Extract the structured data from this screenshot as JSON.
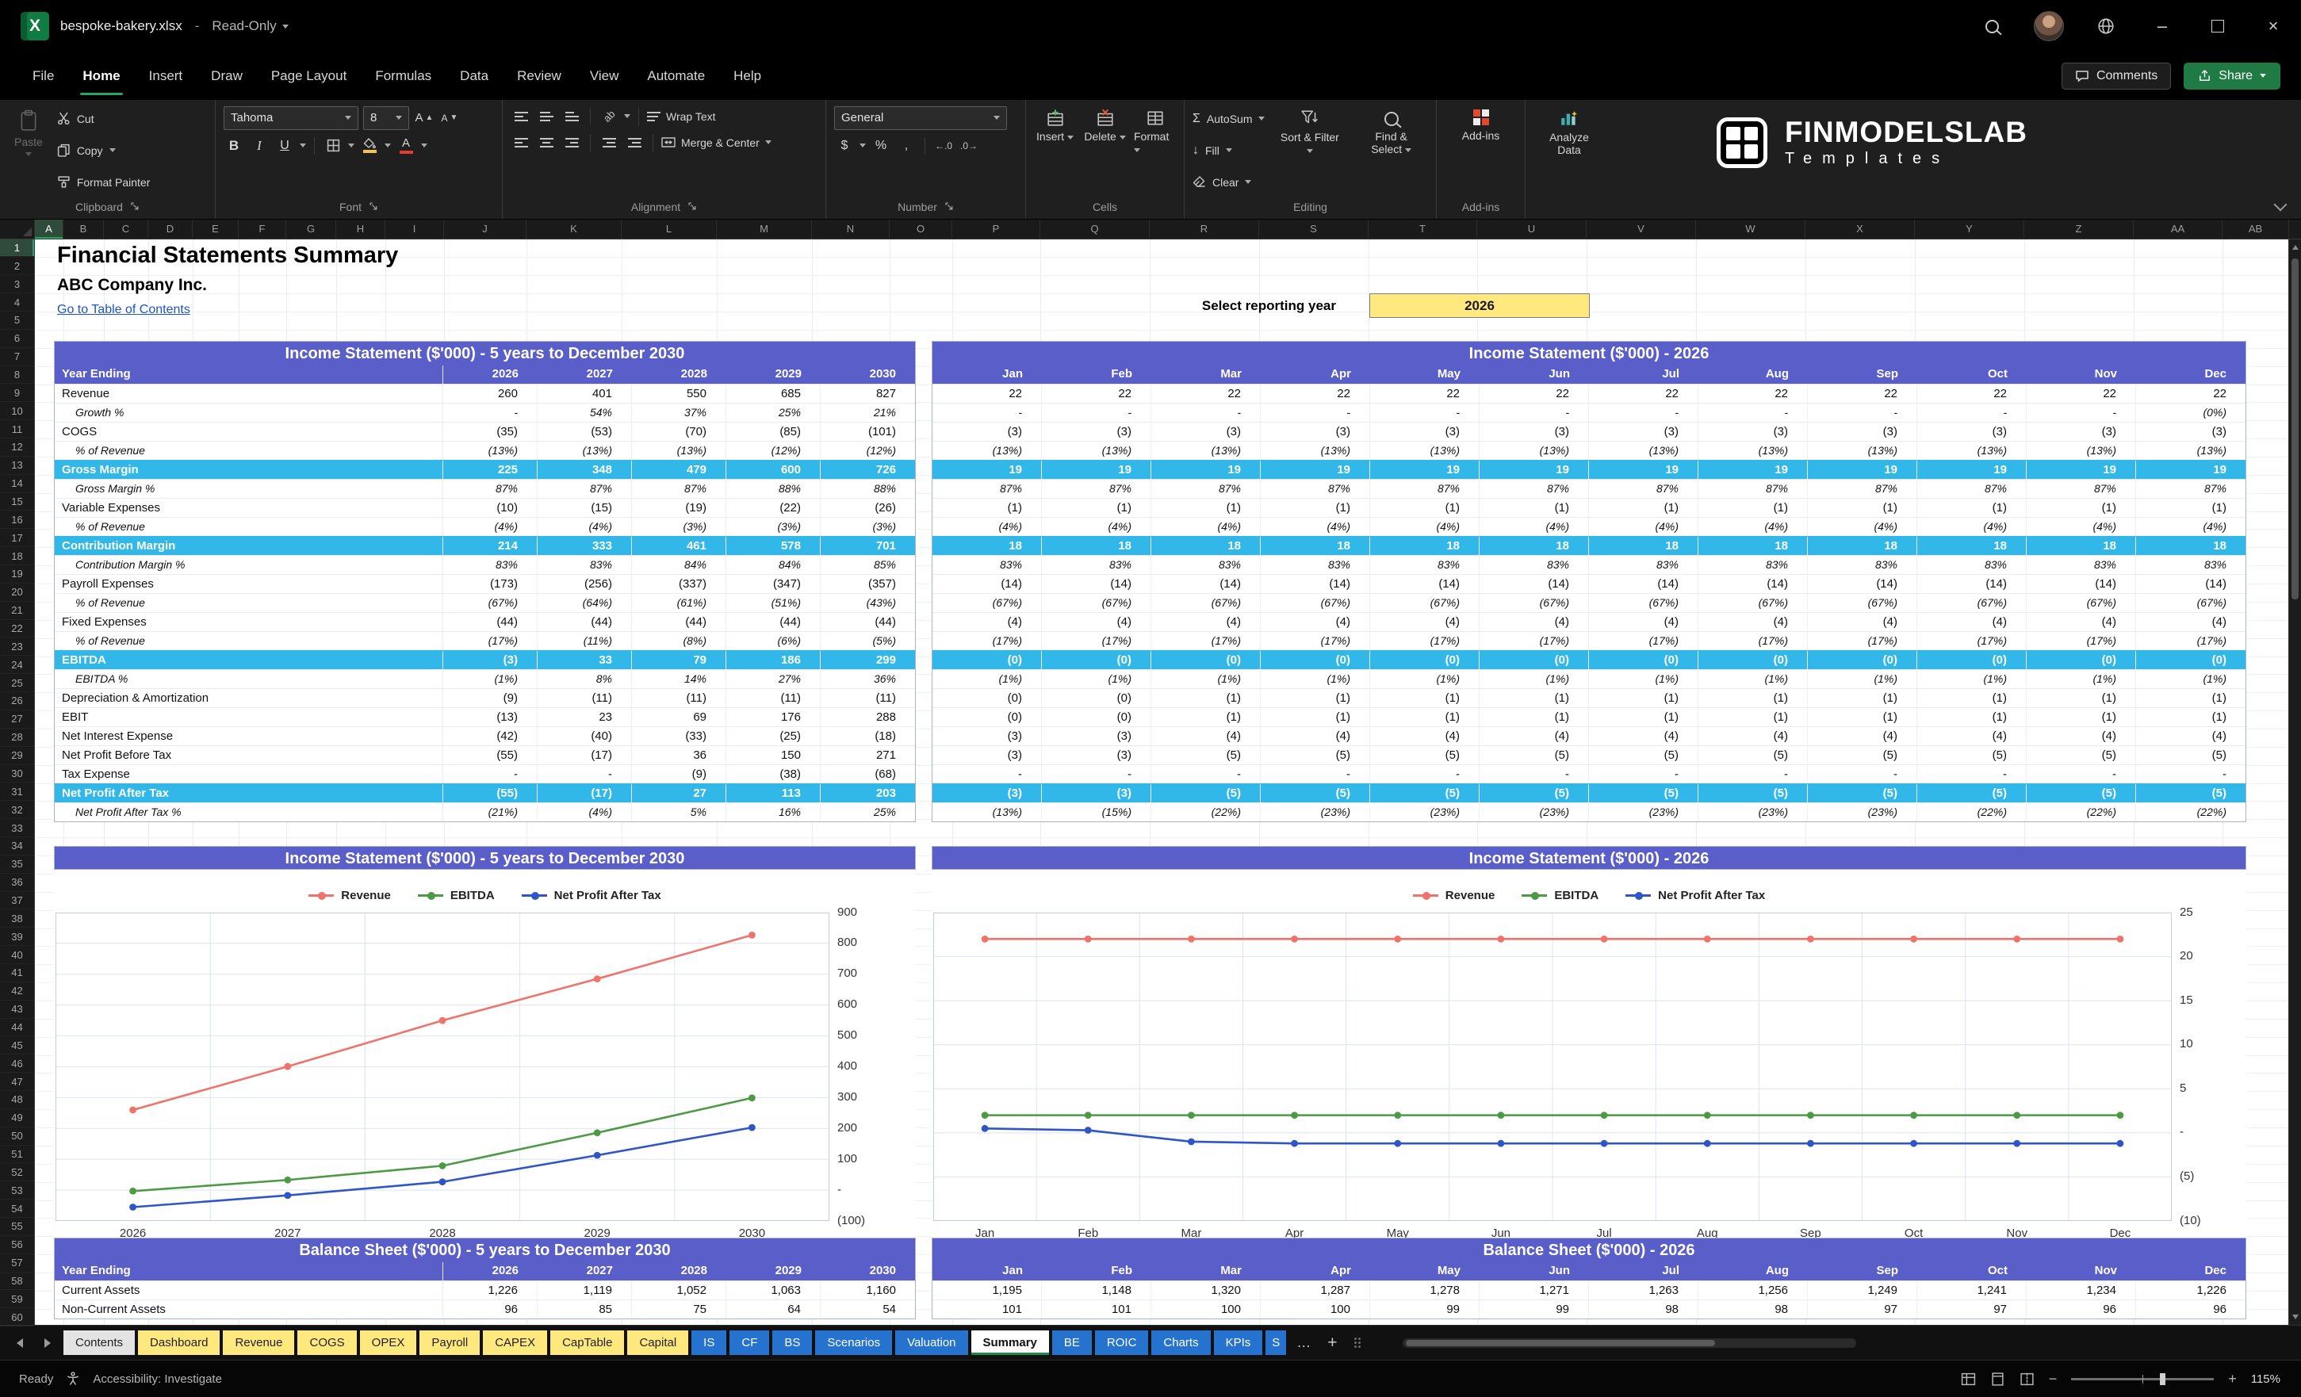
{
  "theme": {
    "accent_purple": "#5a5ec8",
    "accent_cyan": "#31b8e9",
    "tab_yellow": "#ffe97f",
    "tab_blue": "#2573ce",
    "link_blue": "#1b55c8",
    "share_green": "#1f7a44",
    "input_yellow": "#ffe97f",
    "series_revenue": "#f0736b",
    "series_ebitda": "#4c9a44",
    "series_npat": "#2f55c8"
  },
  "icons": {
    "app_letter": "X",
    "minimize": "–",
    "close": "×",
    "sigma": "Σ",
    "dollar": "$",
    "percent": "%",
    "comma": ",",
    "arrow_down": "↓",
    "letter_A": "A",
    "ab": "ab",
    "more": "…",
    "plus": "+",
    "minus": "−",
    "dec_left": "←.0",
    "dec_right": ".0→"
  },
  "titlebar": {
    "filename": "bespoke-bakery.xlsx",
    "separator": "-",
    "mode": "Read-Only"
  },
  "menubar": {
    "items": [
      "File",
      "Home",
      "Insert",
      "Draw",
      "Page Layout",
      "Formulas",
      "Data",
      "Review",
      "View",
      "Automate",
      "Help"
    ],
    "active": "Home",
    "comments": "Comments",
    "share": "Share"
  },
  "ribbon": {
    "clipboard": {
      "label": "Clipboard",
      "paste": "Paste",
      "cut": "Cut",
      "copy": "Copy",
      "format_painter": "Format Painter"
    },
    "font": {
      "label": "Font",
      "name": "Tahoma",
      "size": "8"
    },
    "alignment": {
      "label": "Alignment",
      "wrap": "Wrap Text",
      "merge": "Merge & Center"
    },
    "number": {
      "label": "Number",
      "format": "General"
    },
    "cells": {
      "label": "Cells",
      "insert": "Insert",
      "delete": "Delete",
      "format": "Format"
    },
    "editing": {
      "label": "Editing",
      "autosum": "AutoSum",
      "fill": "Fill",
      "clear": "Clear",
      "sort": "Sort & Filter",
      "find": "Find & Select"
    },
    "addins": {
      "label": "Add-ins",
      "group": "Add-ins"
    },
    "analyze": {
      "label": "Analyze Data"
    },
    "logo": {
      "brand": "FINMODELSLAB",
      "sub": "Templates"
    }
  },
  "grid": {
    "columns": [
      "A",
      "B",
      "C",
      "D",
      "E",
      "F",
      "G",
      "H",
      "I",
      "J",
      "K",
      "L",
      "M",
      "N",
      "O",
      "P",
      "Q",
      "R",
      "S",
      "T",
      "U",
      "V",
      "W",
      "X",
      "Y",
      "Z",
      "AA",
      "AB"
    ],
    "row_count": 60
  },
  "sheet": {
    "title": "Financial Statements Summary",
    "company": "ABC Company Inc.",
    "toc_link": "Go to Table of Contents",
    "reporting_year_label": "Select reporting year",
    "reporting_year_value": "2026"
  },
  "income_annual": {
    "title": "Income Statement ($'000) - 5 years to December 2030",
    "header_label": "Year Ending",
    "columns": [
      "2026",
      "2027",
      "2028",
      "2029",
      "2030"
    ],
    "rows": [
      {
        "label": "Revenue",
        "style": "normal",
        "values": [
          "260",
          "401",
          "550",
          "685",
          "827"
        ]
      },
      {
        "label": "Growth %",
        "style": "pct",
        "values": [
          "-",
          "54%",
          "37%",
          "25%",
          "21%"
        ]
      },
      {
        "label": "COGS",
        "style": "normal",
        "values": [
          "(35)",
          "(53)",
          "(70)",
          "(85)",
          "(101)"
        ]
      },
      {
        "label": "% of Revenue",
        "style": "pct",
        "values": [
          "(13%)",
          "(13%)",
          "(13%)",
          "(12%)",
          "(12%)"
        ]
      },
      {
        "label": "Gross Margin",
        "style": "tot",
        "values": [
          "225",
          "348",
          "479",
          "600",
          "726"
        ]
      },
      {
        "label": "Gross Margin %",
        "style": "pct",
        "values": [
          "87%",
          "87%",
          "87%",
          "88%",
          "88%"
        ]
      },
      {
        "label": "Variable Expenses",
        "style": "normal",
        "values": [
          "(10)",
          "(15)",
          "(19)",
          "(22)",
          "(26)"
        ]
      },
      {
        "label": "% of Revenue",
        "style": "pct",
        "values": [
          "(4%)",
          "(4%)",
          "(3%)",
          "(3%)",
          "(3%)"
        ]
      },
      {
        "label": "Contribution Margin",
        "style": "tot",
        "values": [
          "214",
          "333",
          "461",
          "578",
          "701"
        ]
      },
      {
        "label": "Contribution Margin %",
        "style": "pct",
        "values": [
          "83%",
          "83%",
          "84%",
          "84%",
          "85%"
        ]
      },
      {
        "label": "Payroll Expenses",
        "style": "normal",
        "values": [
          "(173)",
          "(256)",
          "(337)",
          "(347)",
          "(357)"
        ]
      },
      {
        "label": "% of Revenue",
        "style": "pct",
        "values": [
          "(67%)",
          "(64%)",
          "(61%)",
          "(51%)",
          "(43%)"
        ]
      },
      {
        "label": "Fixed Expenses",
        "style": "normal",
        "values": [
          "(44)",
          "(44)",
          "(44)",
          "(44)",
          "(44)"
        ]
      },
      {
        "label": "% of Revenue",
        "style": "pct",
        "values": [
          "(17%)",
          "(11%)",
          "(8%)",
          "(6%)",
          "(5%)"
        ]
      },
      {
        "label": "EBITDA",
        "style": "tot",
        "values": [
          "(3)",
          "33",
          "79",
          "186",
          "299"
        ]
      },
      {
        "label": "EBITDA %",
        "style": "pct",
        "values": [
          "(1%)",
          "8%",
          "14%",
          "27%",
          "36%"
        ]
      },
      {
        "label": "Depreciation & Amortization",
        "style": "normal",
        "values": [
          "(9)",
          "(11)",
          "(11)",
          "(11)",
          "(11)"
        ]
      },
      {
        "label": "EBIT",
        "style": "normal",
        "values": [
          "(13)",
          "23",
          "69",
          "176",
          "288"
        ]
      },
      {
        "label": "Net Interest Expense",
        "style": "normal",
        "values": [
          "(42)",
          "(40)",
          "(33)",
          "(25)",
          "(18)"
        ]
      },
      {
        "label": "Net Profit Before Tax",
        "style": "normal",
        "values": [
          "(55)",
          "(17)",
          "36",
          "150",
          "271"
        ]
      },
      {
        "label": "Tax Expense",
        "style": "normal",
        "values": [
          "-",
          "-",
          "(9)",
          "(38)",
          "(68)"
        ]
      },
      {
        "label": "Net Profit After Tax",
        "style": "tot",
        "values": [
          "(55)",
          "(17)",
          "27",
          "113",
          "203"
        ]
      },
      {
        "label": "Net Profit After Tax %",
        "style": "pct",
        "values": [
          "(21%)",
          "(4%)",
          "5%",
          "16%",
          "25%"
        ]
      }
    ]
  },
  "income_monthly": {
    "title": "Income Statement ($'000) - 2026",
    "columns": [
      "Jan",
      "Feb",
      "Mar",
      "Apr",
      "May",
      "Jun",
      "Jul",
      "Aug",
      "Sep",
      "Oct",
      "Nov",
      "Dec"
    ],
    "rows": [
      {
        "style": "normal",
        "values": [
          "22",
          "22",
          "22",
          "22",
          "22",
          "22",
          "22",
          "22",
          "22",
          "22",
          "22",
          "22"
        ]
      },
      {
        "style": "pct",
        "values": [
          "-",
          "-",
          "-",
          "-",
          "-",
          "-",
          "-",
          "-",
          "-",
          "-",
          "-",
          "(0%)"
        ]
      },
      {
        "style": "normal",
        "values": [
          "(3)",
          "(3)",
          "(3)",
          "(3)",
          "(3)",
          "(3)",
          "(3)",
          "(3)",
          "(3)",
          "(3)",
          "(3)",
          "(3)"
        ]
      },
      {
        "style": "pct",
        "values": [
          "(13%)",
          "(13%)",
          "(13%)",
          "(13%)",
          "(13%)",
          "(13%)",
          "(13%)",
          "(13%)",
          "(13%)",
          "(13%)",
          "(13%)",
          "(13%)"
        ]
      },
      {
        "style": "tot",
        "values": [
          "19",
          "19",
          "19",
          "19",
          "19",
          "19",
          "19",
          "19",
          "19",
          "19",
          "19",
          "19"
        ]
      },
      {
        "style": "pct",
        "values": [
          "87%",
          "87%",
          "87%",
          "87%",
          "87%",
          "87%",
          "87%",
          "87%",
          "87%",
          "87%",
          "87%",
          "87%"
        ]
      },
      {
        "style": "normal",
        "values": [
          "(1)",
          "(1)",
          "(1)",
          "(1)",
          "(1)",
          "(1)",
          "(1)",
          "(1)",
          "(1)",
          "(1)",
          "(1)",
          "(1)"
        ]
      },
      {
        "style": "pct",
        "values": [
          "(4%)",
          "(4%)",
          "(4%)",
          "(4%)",
          "(4%)",
          "(4%)",
          "(4%)",
          "(4%)",
          "(4%)",
          "(4%)",
          "(4%)",
          "(4%)"
        ]
      },
      {
        "style": "tot",
        "values": [
          "18",
          "18",
          "18",
          "18",
          "18",
          "18",
          "18",
          "18",
          "18",
          "18",
          "18",
          "18"
        ]
      },
      {
        "style": "pct",
        "values": [
          "83%",
          "83%",
          "83%",
          "83%",
          "83%",
          "83%",
          "83%",
          "83%",
          "83%",
          "83%",
          "83%",
          "83%"
        ]
      },
      {
        "style": "normal",
        "values": [
          "(14)",
          "(14)",
          "(14)",
          "(14)",
          "(14)",
          "(14)",
          "(14)",
          "(14)",
          "(14)",
          "(14)",
          "(14)",
          "(14)"
        ]
      },
      {
        "style": "pct",
        "values": [
          "(67%)",
          "(67%)",
          "(67%)",
          "(67%)",
          "(67%)",
          "(67%)",
          "(67%)",
          "(67%)",
          "(67%)",
          "(67%)",
          "(67%)",
          "(67%)"
        ]
      },
      {
        "style": "normal",
        "values": [
          "(4)",
          "(4)",
          "(4)",
          "(4)",
          "(4)",
          "(4)",
          "(4)",
          "(4)",
          "(4)",
          "(4)",
          "(4)",
          "(4)"
        ]
      },
      {
        "style": "pct",
        "values": [
          "(17%)",
          "(17%)",
          "(17%)",
          "(17%)",
          "(17%)",
          "(17%)",
          "(17%)",
          "(17%)",
          "(17%)",
          "(17%)",
          "(17%)",
          "(17%)"
        ]
      },
      {
        "style": "tot",
        "values": [
          "(0)",
          "(0)",
          "(0)",
          "(0)",
          "(0)",
          "(0)",
          "(0)",
          "(0)",
          "(0)",
          "(0)",
          "(0)",
          "(0)"
        ]
      },
      {
        "style": "pct",
        "values": [
          "(1%)",
          "(1%)",
          "(1%)",
          "(1%)",
          "(1%)",
          "(1%)",
          "(1%)",
          "(1%)",
          "(1%)",
          "(1%)",
          "(1%)",
          "(1%)"
        ]
      },
      {
        "style": "normal",
        "values": [
          "(0)",
          "(0)",
          "(1)",
          "(1)",
          "(1)",
          "(1)",
          "(1)",
          "(1)",
          "(1)",
          "(1)",
          "(1)",
          "(1)"
        ]
      },
      {
        "style": "normal",
        "values": [
          "(0)",
          "(0)",
          "(1)",
          "(1)",
          "(1)",
          "(1)",
          "(1)",
          "(1)",
          "(1)",
          "(1)",
          "(1)",
          "(1)"
        ]
      },
      {
        "style": "normal",
        "values": [
          "(3)",
          "(3)",
          "(4)",
          "(4)",
          "(4)",
          "(4)",
          "(4)",
          "(4)",
          "(4)",
          "(4)",
          "(4)",
          "(4)"
        ]
      },
      {
        "style": "normal",
        "values": [
          "(3)",
          "(3)",
          "(5)",
          "(5)",
          "(5)",
          "(5)",
          "(5)",
          "(5)",
          "(5)",
          "(5)",
          "(5)",
          "(5)"
        ]
      },
      {
        "style": "normal",
        "values": [
          "-",
          "-",
          "-",
          "-",
          "-",
          "-",
          "-",
          "-",
          "-",
          "-",
          "-",
          "-"
        ]
      },
      {
        "style": "tot",
        "values": [
          "(3)",
          "(3)",
          "(5)",
          "(5)",
          "(5)",
          "(5)",
          "(5)",
          "(5)",
          "(5)",
          "(5)",
          "(5)",
          "(5)"
        ]
      },
      {
        "style": "pct",
        "values": [
          "(13%)",
          "(15%)",
          "(22%)",
          "(23%)",
          "(23%)",
          "(23%)",
          "(23%)",
          "(23%)",
          "(23%)",
          "(22%)",
          "(22%)",
          "(22%)"
        ]
      }
    ]
  },
  "balance_annual": {
    "title": "Balance Sheet ($'000) - 5 years to December 2030",
    "header_label": "Year Ending",
    "columns": [
      "2026",
      "2027",
      "2028",
      "2029",
      "2030"
    ],
    "rows": [
      {
        "label": "Current Assets",
        "style": "normal",
        "values": [
          "1,226",
          "1,119",
          "1,052",
          "1,063",
          "1,160"
        ]
      },
      {
        "label": "Non-Current Assets",
        "style": "normal",
        "values": [
          "96",
          "85",
          "75",
          "64",
          "54"
        ]
      }
    ]
  },
  "balance_monthly": {
    "title": "Balance Sheet ($'000) - 2026",
    "columns": [
      "Jan",
      "Feb",
      "Mar",
      "Apr",
      "May",
      "Jun",
      "Jul",
      "Aug",
      "Sep",
      "Oct",
      "Nov",
      "Dec"
    ],
    "rows": [
      {
        "style": "normal",
        "values": [
          "1,195",
          "1,148",
          "1,320",
          "1,287",
          "1,278",
          "1,271",
          "1,263",
          "1,256",
          "1,249",
          "1,241",
          "1,234",
          "1,226"
        ]
      },
      {
        "style": "normal",
        "values": [
          "101",
          "101",
          "100",
          "100",
          "99",
          "99",
          "98",
          "98",
          "97",
          "97",
          "96",
          "96"
        ]
      }
    ]
  },
  "chart_data": [
    {
      "type": "line",
      "title": "Income Statement ($'000) - 5 years to December 2030",
      "x": [
        "2026",
        "2027",
        "2028",
        "2029",
        "2030"
      ],
      "series": [
        {
          "name": "Revenue",
          "color": "#f0736b",
          "values": [
            260,
            401,
            550,
            685,
            827
          ]
        },
        {
          "name": "EBITDA",
          "color": "#4c9a44",
          "values": [
            -3,
            33,
            79,
            186,
            299
          ]
        },
        {
          "name": "Net Profit After Tax",
          "color": "#2f55c8",
          "values": [
            -55,
            -17,
            27,
            113,
            203
          ]
        }
      ],
      "ymin": -100,
      "ymax": 900,
      "yticks": [
        "900",
        "800",
        "700",
        "600",
        "500",
        "400",
        "300",
        "200",
        "100",
        "-",
        "(100)"
      ],
      "legend_position": "top",
      "grid": true
    },
    {
      "type": "line",
      "title": "Income Statement ($'000) - 2026",
      "x": [
        "Jan",
        "Feb",
        "Mar",
        "Apr",
        "May",
        "Jun",
        "Jul",
        "Aug",
        "Sep",
        "Oct",
        "Nov",
        "Dec"
      ],
      "series": [
        {
          "name": "Revenue",
          "color": "#f0736b",
          "values": [
            22,
            22,
            22,
            22,
            22,
            22,
            22,
            22,
            22,
            22,
            22,
            22
          ]
        },
        {
          "name": "EBITDA",
          "color": "#4c9a44",
          "values": [
            2,
            2,
            2,
            2,
            2,
            2,
            2,
            2,
            2,
            2,
            2,
            2
          ]
        },
        {
          "name": "Net Profit After Tax",
          "color": "#2f55c8",
          "values": [
            0.5,
            0.3,
            -1,
            -1.2,
            -1.2,
            -1.2,
            -1.2,
            -1.2,
            -1.2,
            -1.2,
            -1.2,
            -1.2
          ]
        }
      ],
      "ymin": -10,
      "ymax": 25,
      "yticks": [
        "25",
        "20",
        "15",
        "10",
        "5",
        "-",
        "(5)",
        "(10)"
      ],
      "legend_position": "top",
      "grid": true
    }
  ],
  "sheet_tabs": {
    "tabs": [
      {
        "label": "Contents",
        "color": "gray"
      },
      {
        "label": "Dashboard",
        "color": "yellow"
      },
      {
        "label": "Revenue",
        "color": "yellow"
      },
      {
        "label": "COGS",
        "color": "yellow"
      },
      {
        "label": "OPEX",
        "color": "yellow"
      },
      {
        "label": "Payroll",
        "color": "yellow"
      },
      {
        "label": "CAPEX",
        "color": "yellow"
      },
      {
        "label": "CapTable",
        "color": "yellow"
      },
      {
        "label": "Capital",
        "color": "yellow"
      },
      {
        "label": "IS",
        "color": "blue"
      },
      {
        "label": "CF",
        "color": "blue"
      },
      {
        "label": "BS",
        "color": "blue"
      },
      {
        "label": "Scenarios",
        "color": "blue"
      },
      {
        "label": "Valuation",
        "color": "blue"
      },
      {
        "label": "Summary",
        "color": "active"
      },
      {
        "label": "BE",
        "color": "blue"
      },
      {
        "label": "ROIC",
        "color": "blue"
      },
      {
        "label": "Charts",
        "color": "blue"
      },
      {
        "label": "KPIs",
        "color": "blue"
      },
      {
        "label": "S",
        "color": "blue",
        "partial": true
      }
    ]
  },
  "statusbar": {
    "ready": "Ready",
    "accessibility": "Accessibility: Investigate",
    "zoom": "115%"
  }
}
